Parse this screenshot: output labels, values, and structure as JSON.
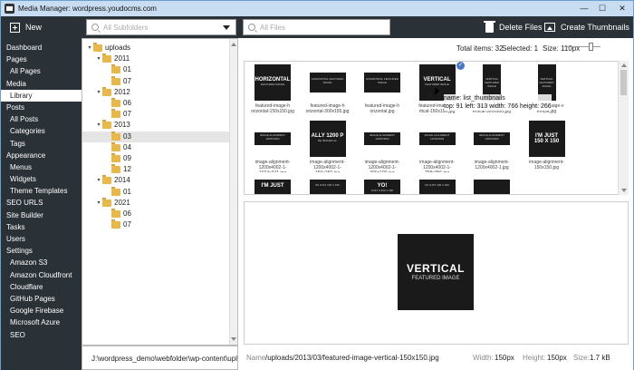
{
  "window": {
    "title": "Media Manager: wordpress.youdocms.com",
    "min": "—",
    "max": "☐",
    "close": "✕"
  },
  "toolbar": {
    "new_label": "New",
    "subfolders_placeholder": "All Subfolders",
    "files_placeholder": "All Files",
    "delete_label": "Delete Files",
    "create_label": "Create Thumbnails"
  },
  "sidebar": {
    "items": [
      {
        "label": "Dashboard",
        "sub": false
      },
      {
        "label": "Pages",
        "sub": false
      },
      {
        "label": "All Pages",
        "sub": true
      },
      {
        "label": "Media",
        "sub": false
      },
      {
        "label": "Library",
        "sub": true,
        "active": true
      },
      {
        "label": "Posts",
        "sub": false
      },
      {
        "label": "All Posts",
        "sub": true
      },
      {
        "label": "Categories",
        "sub": true
      },
      {
        "label": "Tags",
        "sub": true
      },
      {
        "label": "Appearance",
        "sub": false
      },
      {
        "label": "Menus",
        "sub": true
      },
      {
        "label": "Widgets",
        "sub": true
      },
      {
        "label": "Theme Templates",
        "sub": true
      },
      {
        "label": "SEO URLS",
        "sub": false
      },
      {
        "label": "Site Builder",
        "sub": false
      },
      {
        "label": "Tasks",
        "sub": false
      },
      {
        "label": "Users",
        "sub": false
      },
      {
        "label": "Settings",
        "sub": false
      },
      {
        "label": "Amazon S3",
        "sub": true
      },
      {
        "label": "Amazon Cloudfront",
        "sub": true
      },
      {
        "label": "Cloudflare",
        "sub": true
      },
      {
        "label": "GitHub Pages",
        "sub": true
      },
      {
        "label": "Google Firebase",
        "sub": true
      },
      {
        "label": "Microsoft Azure",
        "sub": true
      },
      {
        "label": "SEO",
        "sub": true
      }
    ]
  },
  "tree": [
    {
      "label": "uploads",
      "level": 0,
      "exp": "▾"
    },
    {
      "label": "2011",
      "level": 1,
      "exp": "▾"
    },
    {
      "label": "01",
      "level": 2,
      "exp": ""
    },
    {
      "label": "07",
      "level": 2,
      "exp": ""
    },
    {
      "label": "2012",
      "level": 1,
      "exp": "▾"
    },
    {
      "label": "06",
      "level": 2,
      "exp": ""
    },
    {
      "label": "07",
      "level": 2,
      "exp": ""
    },
    {
      "label": "2013",
      "level": 1,
      "exp": "▾"
    },
    {
      "label": "03",
      "level": 2,
      "exp": "",
      "selected": true
    },
    {
      "label": "04",
      "level": 2,
      "exp": ""
    },
    {
      "label": "09",
      "level": 2,
      "exp": ""
    },
    {
      "label": "12",
      "level": 2,
      "exp": ""
    },
    {
      "label": "2014",
      "level": 1,
      "exp": "▾"
    },
    {
      "label": "01",
      "level": 2,
      "exp": ""
    },
    {
      "label": "2021",
      "level": 1,
      "exp": "▾"
    },
    {
      "label": "06",
      "level": 2,
      "exp": ""
    },
    {
      "label": "07",
      "level": 2,
      "exp": ""
    }
  ],
  "path": "J:\\wordpress_demo\\webfolder\\wp-content\\uploa",
  "stats": {
    "total": "Total items: 32",
    "selected": "Selected: 1",
    "size": "Size: 110px"
  },
  "thumbs": [
    {
      "t1": "HORIZONTAL",
      "t2": "FEATURED IMAGE",
      "cap": "featured-image-h\norizontal-150x150.jpg"
    },
    {
      "t1": "",
      "t2": "HORIZONTAL FEATURED IMAGE",
      "cap": "featured-image-h\norizontal-300x155.jpg"
    },
    {
      "t1": "",
      "t2": "HORIZONTAL FEATURED IMAGE",
      "cap": "featured-image-h\norizontal.jpg"
    },
    {
      "t1": "VERTICAL",
      "t2": "FEATURED IMAGE",
      "cap": "featured-image-ve\nrtical-150x150.jpg"
    },
    {
      "t1": "",
      "t2": "VERTICAL FEATURED IMAGE",
      "cap": "featured-image-v\nertical-300x900.jpg"
    },
    {
      "t1": "",
      "t2": "VERTICAL FEATURED IMAGE",
      "cap": "featured-image-v\nertical.jpg"
    },
    {
      "t1": "",
      "t2": "IMAGE ALIGNMENT 1200X4002",
      "cap": "image-alignment-\n1200x4002-1-1024x341.jpg"
    },
    {
      "t1": "ALLY 1200 P",
      "t2": "DE IMAGES AL",
      "cap": "image-alignment-\n1200x4002-1-150x150.jpg"
    },
    {
      "t1": "",
      "t2": "IMAGE ALIGNMENT 1200X4002",
      "cap": "image-alignment-\n1200x4002-1-300x100.jpg"
    },
    {
      "t1": "",
      "t2": "IMAGE ALIGNMENT 1200X4002",
      "cap": "image-alignment-\n1200x4002-1-768x256.jpg"
    },
    {
      "t1": "",
      "t2": "IMAGE ALIGNMENT 1200X4002",
      "cap": "image-alignment-\n1200x4002-1.jpg"
    },
    {
      "t1": "I'M JUST\n150 X 150",
      "t2": "",
      "cap": "image-alignment-\n150x150.jpg"
    },
    {
      "t1": "I'M JUST",
      "t2": "",
      "cap": ""
    },
    {
      "t1": "",
      "t2": "I'M JUST 150 X 150",
      "cap": ""
    },
    {
      "t1": "YO!",
      "t2": "JUST A 300 X 200",
      "cap": ""
    },
    {
      "t1": "",
      "t2": "I'M JUST 300 X 200",
      "cap": ""
    },
    {
      "t1": "",
      "t2": "",
      "cap": ""
    }
  ],
  "tooltip": {
    "line1": "name: list_thumbnails",
    "line2": "top: 91 left: 313 width: 766 height: 266"
  },
  "preview": {
    "t1": "VERTICAL",
    "t2": "FEATURED IMAGE"
  },
  "status": {
    "name_label": "Name",
    "name_value": "/uploads/2013/03/featured-image-vertical-150x150.jpg",
    "width_label": "Width:",
    "width_value": "150px",
    "height_label": "Height:",
    "height_value": "150px",
    "size_label": "Size:",
    "size_value": "1.7 kB"
  },
  "colors": {
    "dark": "#2a3137",
    "titlebar": "#c8ddf2",
    "accent": "#4a78c4"
  }
}
